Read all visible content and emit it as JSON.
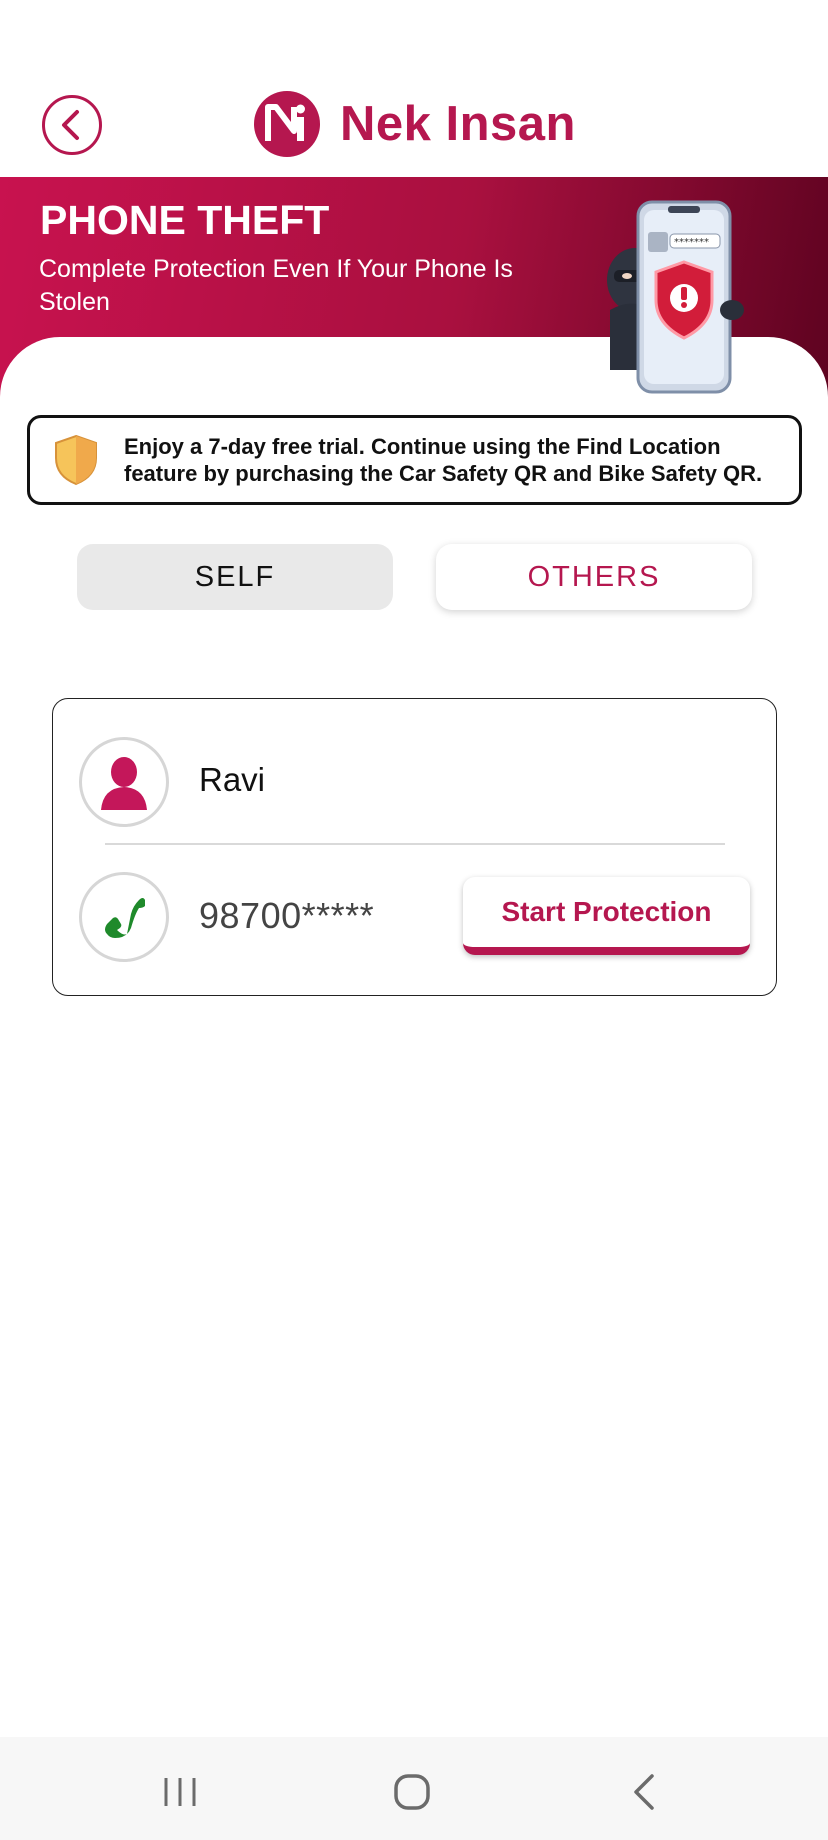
{
  "header": {
    "back_icon": "chevron-left-icon",
    "logo_name": "Nek Insan",
    "brand_color": "#b5174f"
  },
  "banner": {
    "title": "PHONE THEFT",
    "subtitle": "Complete Protection Even If Your Phone Is Stolen",
    "illustration": "thief-with-phone-shield-illustration",
    "phone_screen_text": "*******"
  },
  "notice": {
    "icon": "shield-icon",
    "text": "Enjoy a 7-day free trial. Continue using the Find Location feature by purchasing the Car Safety QR and Bike Safety QR."
  },
  "tabs": {
    "self_label": "SELF",
    "others_label": "OTHERS",
    "selected": "SELF"
  },
  "card": {
    "name": "Ravi",
    "phone": "98700*****",
    "person_icon": "person-icon",
    "phone_icon": "phone-icon",
    "start_button_label": "Start Protection"
  },
  "navbar": {
    "recents_icon": "recents-icon",
    "home_icon": "home-icon",
    "back_icon": "back-icon"
  }
}
